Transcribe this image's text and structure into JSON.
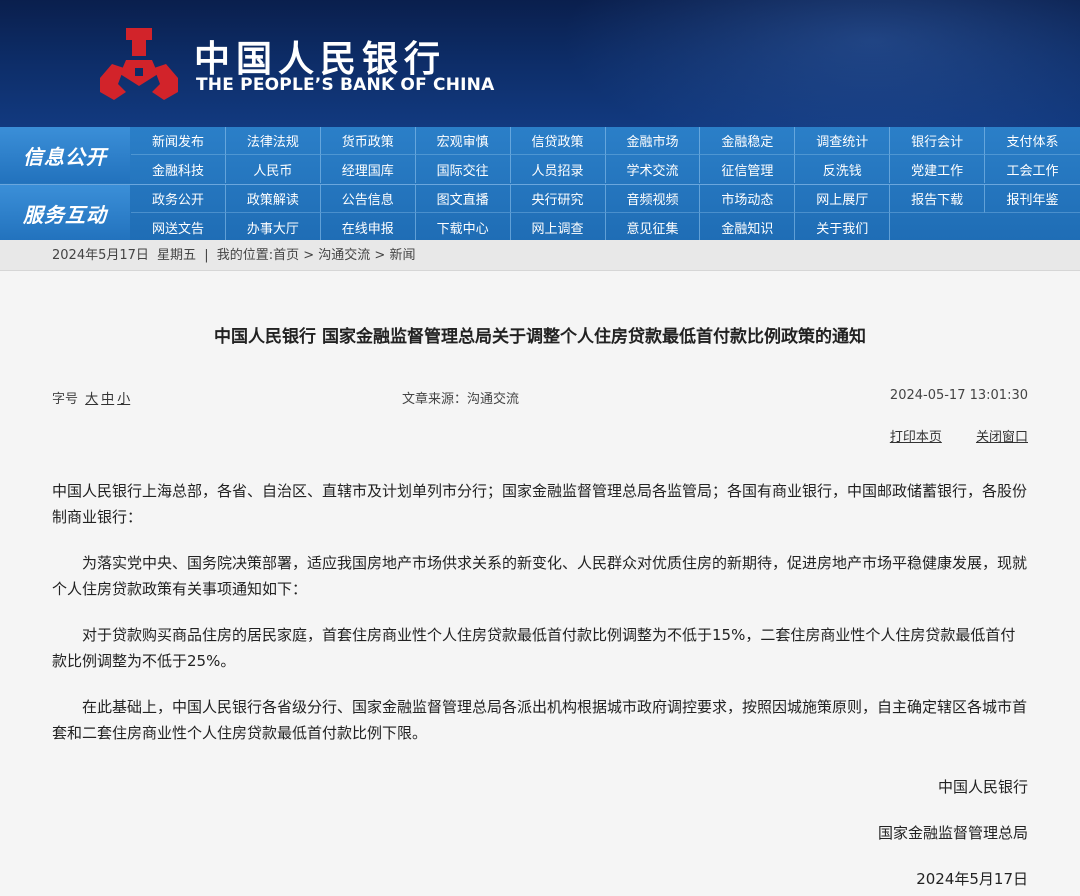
{
  "header": {
    "logo_cn": "中国人民银行",
    "logo_en": "THE PEOPLE’S BANK OF CHINA",
    "colors": {
      "emblem_red": "#d2232a",
      "header_bg": "#0d2c66",
      "nav_bg": "#2272bd"
    }
  },
  "nav": {
    "section1_label": "信息公开",
    "section1_items": [
      "新闻发布",
      "法律法规",
      "货币政策",
      "宏观审慎",
      "信贷政策",
      "金融市场",
      "金融稳定",
      "调查统计",
      "银行会计",
      "支付体系",
      "金融科技",
      "人民币",
      "经理国库",
      "国际交往",
      "人员招录",
      "学术交流",
      "征信管理",
      "反洗钱",
      "党建工作",
      "工会工作"
    ],
    "section2_label": "服务互动",
    "section2_items": [
      "政务公开",
      "政策解读",
      "公告信息",
      "图文直播",
      "央行研究",
      "音频视频",
      "市场动态",
      "网上展厅",
      "报告下载",
      "报刊年鉴",
      "网送文告",
      "办事大厅",
      "在线申报",
      "下载中心",
      "网上调查",
      "意见征集",
      "金融知识",
      "关于我们"
    ]
  },
  "breadcrumb": {
    "date": "2024年5月17日",
    "weekday": "星期五",
    "sep": "|",
    "location_label": "我的位置:",
    "path": "首页 > 沟通交流 > 新闻"
  },
  "article": {
    "title": "中国人民银行 国家金融监督管理总局关于调整个人住房贷款最低首付款比例政策的通知",
    "font_size_label": "字号",
    "size_large": "大",
    "size_medium": "中",
    "size_small": "小",
    "source": "文章来源：沟通交流",
    "time": "2024-05-17 13:01:30",
    "print": "打印本页",
    "close": "关闭窗口",
    "paragraphs": [
      "中国人民银行上海总部，各省、自治区、直辖市及计划单列市分行；国家金融监督管理总局各监管局；各国有商业银行，中国邮政储蓄银行，各股份制商业银行：",
      "为落实党中央、国务院决策部署，适应我国房地产市场供求关系的新变化、人民群众对优质住房的新期待，促进房地产市场平稳健康发展，现就个人住房贷款政策有关事项通知如下：",
      "对于贷款购买商品住房的居民家庭，首套住房商业性个人住房贷款最低首付款比例调整为不低于15%，二套住房商业性个人住房贷款最低首付款比例调整为不低于25%。",
      "在此基础上，中国人民银行各省级分行、国家金融监督管理总局各派出机构根据城市政府调控要求，按照因城施策原则，自主确定辖区各城市首套和二套住房商业性个人住房贷款最低首付款比例下限。"
    ],
    "sign_1": "中国人民银行",
    "sign_2": "国家金融监督管理总局",
    "sign_date": "2024年5月17日"
  }
}
